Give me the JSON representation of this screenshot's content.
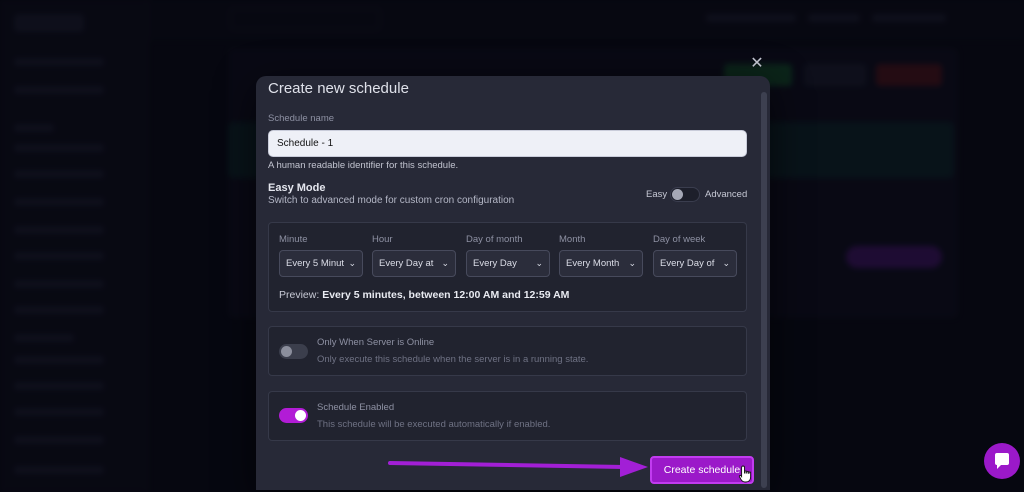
{
  "modal": {
    "title": "Create new schedule",
    "close_glyph": "✕",
    "schedule_name": {
      "label": "Schedule name",
      "value": "Schedule - 1",
      "hint": "A human readable identifier for this schedule."
    },
    "easy_mode": {
      "title": "Easy Mode",
      "subtitle": "Switch to advanced mode for custom cron configuration",
      "easy_label": "Easy",
      "advanced_label": "Advanced"
    },
    "cron": {
      "fields": [
        {
          "label": "Minute",
          "value": "Every 5 Minut"
        },
        {
          "label": "Hour",
          "value": "Every Day at"
        },
        {
          "label": "Day of month",
          "value": "Every Day"
        },
        {
          "label": "Month",
          "value": "Every Month"
        },
        {
          "label": "Day of week",
          "value": "Every Day of"
        }
      ],
      "preview_prefix": "Preview:",
      "preview_value": "Every 5 minutes, between 12:00 AM and 12:59 AM"
    },
    "only_online": {
      "title": "Only When Server is Online",
      "description": "Only execute this schedule when the server is in a running state."
    },
    "enabled": {
      "title": "Schedule Enabled",
      "description": "This schedule will be executed automatically if enabled."
    },
    "create_label": "Create schedule"
  },
  "colors": {
    "accent": "#9b19c9",
    "modal_bg": "#272937",
    "arrow": "#a21fd6"
  }
}
